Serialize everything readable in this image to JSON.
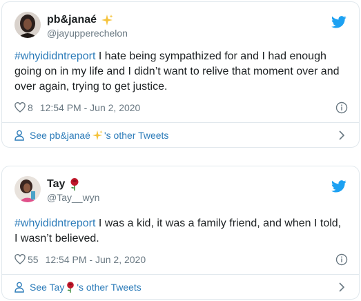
{
  "tweets": [
    {
      "display_name": "pb&janaé",
      "name_emoji": "sparkles-icon",
      "handle": "@jayupperechelon",
      "hashtag": "#whyididntreport",
      "text_line1": " I hate being sympathized for and I had enough",
      "text_line2": "going on in my life and I didn’t want to relive that moment over and",
      "text_line3": "over again, trying to get justice.",
      "likes": "8",
      "timestamp": "12:54 PM - Jun 2, 2020",
      "footer_prefix": "See pb&janaé",
      "footer_suffix": "'s other Tweets"
    },
    {
      "display_name": "Tay",
      "name_emoji": "rose-icon",
      "handle": "@Tay__wyn",
      "hashtag": "#whyididntreport",
      "text_line1": " I was a kid, it was a family friend, and when I told,",
      "text_line2": "I wasn’t believed.",
      "likes": "55",
      "timestamp": "12:54 PM - Jun 2, 2020",
      "footer_prefix": "See Tay",
      "footer_suffix": "'s other Tweets"
    }
  ],
  "colors": {
    "link": "#2b7bb9",
    "twitter_blue": "#1da1f2",
    "muted": "#697882",
    "border": "#e1e8ed"
  }
}
